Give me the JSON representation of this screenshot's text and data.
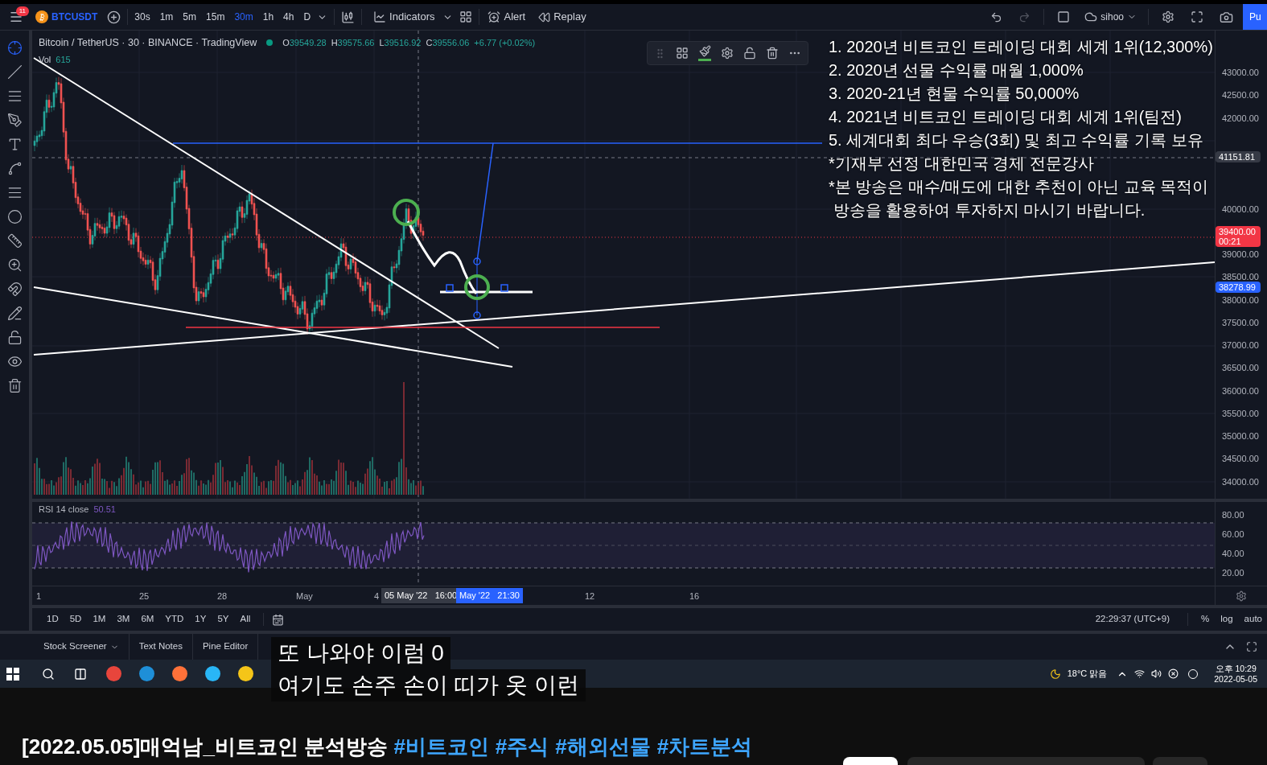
{
  "toolbar": {
    "notification_count": "11",
    "symbol": "BTCUSDT",
    "intervals": [
      {
        "label": "30s",
        "selected": false
      },
      {
        "label": "1m",
        "selected": false
      },
      {
        "label": "5m",
        "selected": false
      },
      {
        "label": "15m",
        "selected": false
      },
      {
        "label": "30m",
        "selected": true
      },
      {
        "label": "1h",
        "selected": false
      },
      {
        "label": "4h",
        "selected": false
      },
      {
        "label": "D",
        "selected": false
      }
    ],
    "indicators": "Indicators",
    "alert": "Alert",
    "replay": "Replay",
    "user": "sihoo",
    "publish": "Pu"
  },
  "legend": {
    "title": "Bitcoin / TetherUS · 30 · BINANCE · TradingView",
    "ohlc": [
      {
        "key": "O",
        "value": "39549.28"
      },
      {
        "key": "H",
        "value": "39575.66"
      },
      {
        "key": "L",
        "value": "39516.92"
      },
      {
        "key": "C",
        "value": "39556.06"
      }
    ],
    "change": "+6.77 (+0.02%)",
    "volume_label": "Vol",
    "volume": "615"
  },
  "overlay_text": [
    "1. 2020년 비트코인 트레이딩 대회 세계 1위(12,300%)",
    "2. 2020년 선물 수익률 매월 1,000%",
    "3. 2020-21년 현물 수익률 50,000%",
    "4. 2021년 비트코인 트레이딩 대회 세계 1위(팀전)",
    "5. 세계대회 최다 우승(3회) 및 최고 수익률 기록 보유",
    "*기재부 선정 대한민국 경제 전문강사",
    "*본 방송은 매수/매도에 대한 추천이 아닌 교육 목적이",
    " 방송을 활용하여 투자하지 마시기 바랍니다."
  ],
  "price_axis": {
    "ticks": [
      "43000.00",
      "42500.00",
      "42000.00",
      "40000.00",
      "39000.00",
      "38500.00",
      "38000.00",
      "37500.00",
      "37000.00",
      "36500.00",
      "36000.00",
      "35500.00",
      "35000.00",
      "34500.00",
      "34000.00"
    ],
    "badges": [
      {
        "kind": "crosshair",
        "label": "41151.81"
      },
      {
        "kind": "last",
        "label": "39400.00",
        "sub": "00:21"
      },
      {
        "kind": "marker",
        "label": "38278.99"
      }
    ]
  },
  "rsi": {
    "title": "RSI 14 close",
    "value": "50.51",
    "ticks": [
      "80.00",
      "60.00",
      "40.00",
      "20.00"
    ]
  },
  "time_axis": {
    "labels": [
      "1",
      "25",
      "28",
      "May",
      "4",
      "12",
      "16"
    ],
    "crosshair_label": "05 May '22   16:00",
    "marker_label": "May '22   21:30"
  },
  "ranges": [
    "1D",
    "5D",
    "1M",
    "3M",
    "6M",
    "YTD",
    "1Y",
    "5Y",
    "All"
  ],
  "clock": "22:29:37 (UTC+9)",
  "scale_options": [
    "%",
    "log",
    "auto"
  ],
  "bottom_tabs": [
    {
      "label": "Stock Screener",
      "dropdown": true
    },
    {
      "label": "Text Notes",
      "dropdown": false
    },
    {
      "label": "Pine Editor",
      "dropdown": false
    }
  ],
  "taskbar": {
    "weather": "18°C 맑음",
    "time": "오후 10:29",
    "date": "2022-05-05"
  },
  "subtitles": [
    "또 나와야 이럼 0",
    "여기도 손주 손이 띠가 옷 이런"
  ],
  "video": {
    "title": "[2022.05.05]매억남_비트코인 분석방송",
    "hashtags": [
      "#비트코인",
      "#주식",
      "#해외선물",
      "#차트분석"
    ]
  }
}
